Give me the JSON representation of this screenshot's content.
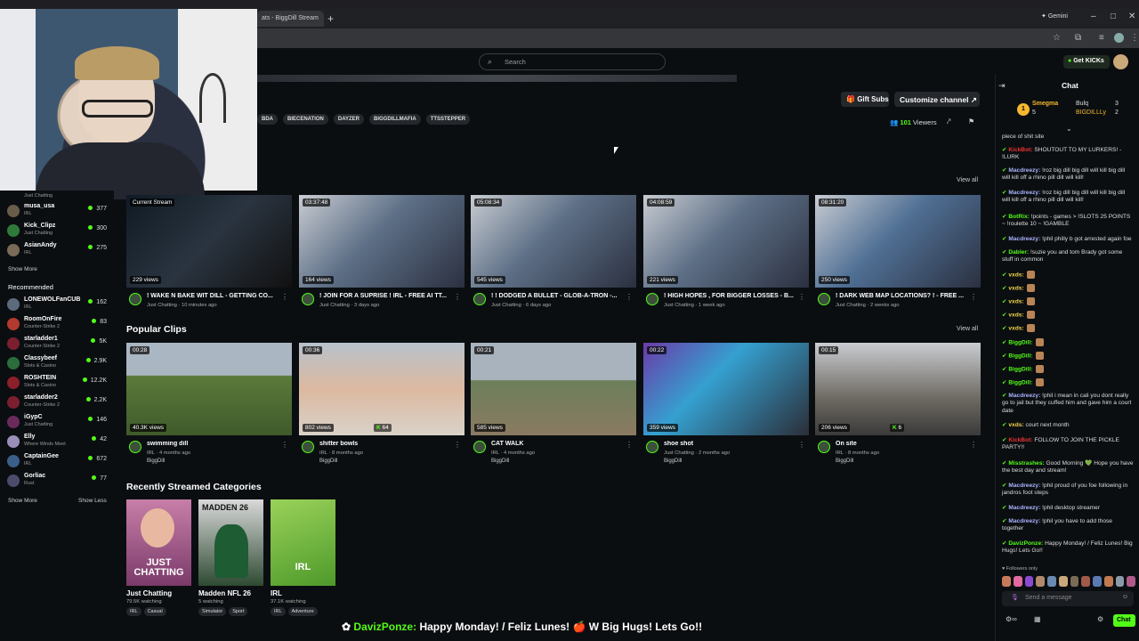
{
  "browser": {
    "tab_title": "ats - BiggDill Stream",
    "new_tab": "+",
    "gemini_label": "Gemini",
    "window_controls": [
      "–",
      "□",
      "✕"
    ]
  },
  "header": {
    "search_placeholder": "Search",
    "get_kicks_label": "Get KICKs",
    "get_kicks_icon": "kick-coin-icon"
  },
  "channel": {
    "gift_subs_label": "Gift Subs",
    "customize_label": "Customize channel ↗",
    "tags": [
      "BDA",
      "BIECENATION",
      "DAYZER",
      "BIGGDILLMAFIA",
      "TTSSTEPPER"
    ],
    "viewers_count": "101",
    "viewers_label": "Viewers"
  },
  "sidebar": {
    "following": [
      {
        "name": "",
        "category": "Just Chatting",
        "count": ""
      },
      {
        "name": "musa_usa",
        "category": "IRL",
        "count": "377",
        "color": "#6a5c4a"
      },
      {
        "name": "Kick_Clipz",
        "category": "Just Chatting",
        "count": "300",
        "color": "#2f7a3a"
      },
      {
        "name": "AsianAndy",
        "category": "IRL",
        "count": "275",
        "color": "#7a6b58"
      }
    ],
    "show_more": "Show More",
    "recommended_title": "Recommended",
    "recommended": [
      {
        "name": "LONEWOLFanCUB",
        "category": "IRL",
        "count": "162",
        "color": "#5b6b7c"
      },
      {
        "name": "RoomOnFire",
        "category": "Counter-Strike 2",
        "count": "83",
        "color": "#b33a2e"
      },
      {
        "name": "starladder1",
        "category": "Counter-Strike 2",
        "count": "5K",
        "color": "#7b1f2f"
      },
      {
        "name": "Classybeef",
        "category": "Slots & Casino",
        "count": "2.9K",
        "color": "#2b6d3a"
      },
      {
        "name": "ROSHTEIN",
        "category": "Slots & Casino",
        "count": "12.2K",
        "color": "#8b1f2a"
      },
      {
        "name": "starladder2",
        "category": "Counter-Strike 2",
        "count": "2.2K",
        "color": "#7b1f2f"
      },
      {
        "name": "iGypC",
        "category": "Just Chatting",
        "count": "146",
        "color": "#6a2a5a"
      },
      {
        "name": "Elly",
        "category": "Where Winds Meet",
        "count": "42",
        "color": "#9a8fb8"
      },
      {
        "name": "CaptainGee",
        "category": "IRL",
        "count": "672",
        "color": "#3a5f8a"
      },
      {
        "name": "Gorliac",
        "category": "Rust",
        "count": "77",
        "color": "#4b4b6b"
      }
    ],
    "show_more_2": "Show More",
    "show_less": "Show Less"
  },
  "videos": {
    "view_all": "View all",
    "items": [
      {
        "badge": "Current Stream",
        "views": "229 views",
        "title": "! WAKE N BAKE WIT DILL - GETTING CO...",
        "sub": "Just Chatting · 10 minutes ago"
      },
      {
        "badge": "03:37:48",
        "views": "164 views",
        "title": "! JOIN FOR A SUPRISE ! IRL - FREE AI TT...",
        "sub": "Just Chatting · 3 days ago"
      },
      {
        "badge": "05:08:34",
        "views": "545 views",
        "title": "! ! DODGED A BULLET - GLOB-A-TRON -...",
        "sub": "Just Chatting · 6 days ago"
      },
      {
        "badge": "04:08:59",
        "views": "221 views",
        "title": "! HIGH HOPES , FOR BIGGER LOSSES - B...",
        "sub": "Just Chatting · 1 week ago"
      },
      {
        "badge": "08:31:20",
        "views": "250 views",
        "title": "! DARK WEB MAP LOCATIONS? ! - FREE ...",
        "sub": "Just Chatting · 2 weeks ago"
      }
    ]
  },
  "clips": {
    "title": "Popular Clips",
    "view_all": "View all",
    "items": [
      {
        "badge": "00:28",
        "views": "40.3K views",
        "title": "swimming dill",
        "sub": "IRL · 4 months ago",
        "author": "BiggDill",
        "extra": ""
      },
      {
        "badge": "00:36",
        "views": "802 views",
        "title": "shitter bowls",
        "sub": "IRL · 8 months ago",
        "author": "BiggDill",
        "extra": "64"
      },
      {
        "badge": "00:21",
        "views": "585 views",
        "title": "CAT WALK",
        "sub": "IRL · 4 months ago",
        "author": "BiggDill",
        "extra": ""
      },
      {
        "badge": "00:22",
        "views": "359 views",
        "title": "shoe shot",
        "sub": "Just Chatting · 2 months ago",
        "author": "BiggDill",
        "extra": ""
      },
      {
        "badge": "00:15",
        "views": "206 views",
        "title": "On site",
        "sub": "IRL · 8 months ago",
        "author": "BiggDill",
        "extra": "6"
      }
    ]
  },
  "categories": {
    "title": "Recently Streamed Categories",
    "items": [
      {
        "name": "Just Chatting",
        "watching": "79.5K watching",
        "tags": [
          "IRL",
          "Casual"
        ],
        "art": "JUST CHATTING"
      },
      {
        "name": "Madden NFL 26",
        "watching": "5 watching",
        "tags": [
          "Simulator",
          "Sport"
        ],
        "art": "MADDEN 26"
      },
      {
        "name": "IRL",
        "watching": "37.1K watching",
        "tags": [
          "IRL",
          "Adventure"
        ],
        "art": "IRL"
      }
    ]
  },
  "chat": {
    "title": "Chat",
    "leaderboard": {
      "first": "Smegma",
      "first_count": "5",
      "second": "Bulq",
      "second_count": "3",
      "third": "BIGDILLLy",
      "third_count": "2"
    },
    "messages": [
      {
        "user": "",
        "text": "piece of shit site",
        "color": "#ddd"
      },
      {
        "user": "KickBot:",
        "text": "SHOUTOUT TO MY LURKERS! - !LURK",
        "color": "#e33"
      },
      {
        "user": "Macdreezy:",
        "text": "!roz big dill big dill will kill big dill will kill off a rhino pill dill will kill!",
        "color": "#aab2ff"
      },
      {
        "user": "Macdreezy:",
        "text": "!roz big dill big dill will kill big dill will kill off a rhino pill dill will kill!",
        "color": "#aab2ff"
      },
      {
        "user": "BotRix:",
        "text": "!points - games > !SLOTS 25 POINTS ~ !roulette 10 ~ !GAMBLE",
        "color": "#53fc18"
      },
      {
        "user": "Macdreezy:",
        "text": "!phil philly b got arrested again foe",
        "color": "#aab2ff"
      },
      {
        "user": "Dabler:",
        "text": "!suzie you and tom Brady got some stuff in common",
        "color": "#53fc18"
      },
      {
        "user": "vxds:",
        "text": "",
        "color": "#f5d54a"
      },
      {
        "user": "vxds:",
        "text": "",
        "color": "#f5d54a"
      },
      {
        "user": "vxds:",
        "text": "",
        "color": "#f5d54a"
      },
      {
        "user": "vxds:",
        "text": "",
        "color": "#f5d54a"
      },
      {
        "user": "vxds:",
        "text": "",
        "color": "#f5d54a"
      },
      {
        "user": "BiggDill:",
        "text": "",
        "color": "#53fc18"
      },
      {
        "user": "BiggDill:",
        "text": "",
        "color": "#53fc18"
      },
      {
        "user": "BiggDill:",
        "text": "",
        "color": "#53fc18"
      },
      {
        "user": "BiggDill:",
        "text": "",
        "color": "#53fc18"
      },
      {
        "user": "Macdreezy:",
        "text": "!phil i mean in cali you dont really go to jail but they cuffed him and gave him a court date",
        "color": "#aab2ff"
      },
      {
        "user": "vxds:",
        "text": "court next month",
        "color": "#f5d54a"
      },
      {
        "user": "KickBot:",
        "text": "FOLLOW TO JOIN THE PICKLE PARTY!!",
        "color": "#e33"
      },
      {
        "user": "Misstrashes:",
        "text": "Good Morning 💚 Hope you have the best day and stream!",
        "color": "#53fc18"
      },
      {
        "user": "Macdreezy:",
        "text": "!phil proud of you foe following in jandros foot steps",
        "color": "#aab2ff"
      },
      {
        "user": "Macdreezy:",
        "text": "!phil desktop streamer",
        "color": "#aab2ff"
      },
      {
        "user": "Macdreezy:",
        "text": "!phil you have to add those together",
        "color": "#aab2ff"
      },
      {
        "user": "DavizPonze:",
        "text": "Happy Monday! / Feliz Lunes! Big Hugs! Lets Go!!",
        "color": "#53fc18"
      }
    ],
    "followers_only": "Followers only",
    "input_placeholder": "Send a message",
    "send_label": "Chat"
  },
  "overlay": {
    "name": "DavizPonze:",
    "text1": "Happy Monday! / Feliz Lunes!",
    "text2": "Big Hugs! Lets Go!!"
  },
  "colors": {
    "accent": "#53fc18",
    "bg": "#0b0e11",
    "panel": "#24272c"
  }
}
